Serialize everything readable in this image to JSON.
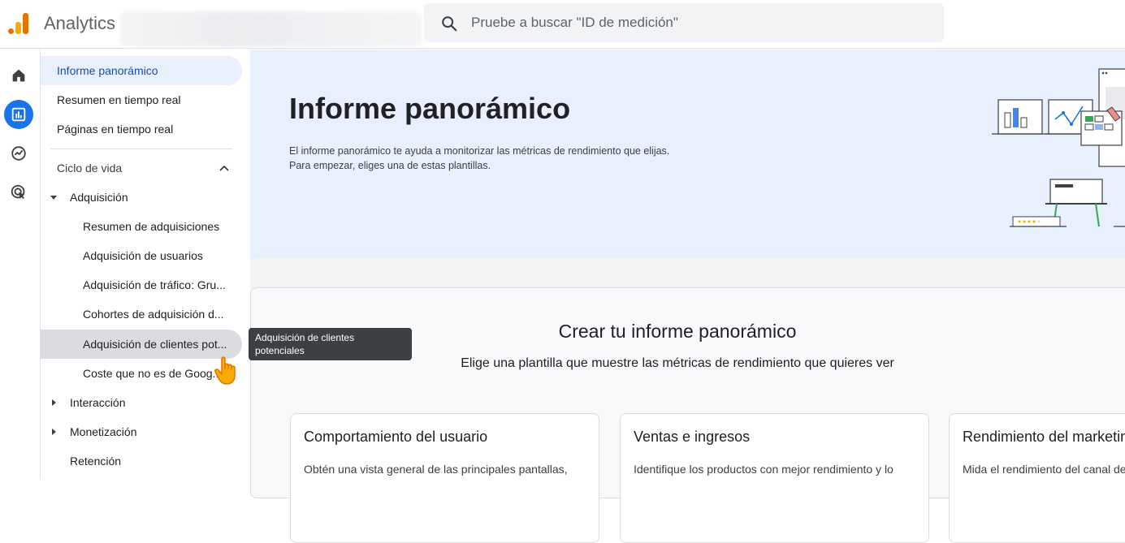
{
  "header": {
    "app_title": "Analytics",
    "search_placeholder": "Pruebe a buscar \"ID de medición\""
  },
  "rail": {
    "items": [
      {
        "icon": "home-icon"
      },
      {
        "icon": "reports-icon",
        "active": true
      },
      {
        "icon": "explore-icon"
      },
      {
        "icon": "advertising-icon"
      }
    ]
  },
  "sidenav": {
    "items": [
      {
        "label": "Informe panorámico"
      },
      {
        "label": "Resumen en tiempo real"
      },
      {
        "label": "Páginas en tiempo real"
      }
    ],
    "section_label": "Ciclo de vida",
    "acquisition": {
      "label": "Adquisición",
      "children": [
        "Resumen de adquisiciones",
        "Adquisición de usuarios",
        "Adquisición de tráfico: Gru...",
        "Cohortes de adquisición d...",
        "Adquisición de clientes pot...",
        "Coste que no es de Goog..."
      ]
    },
    "interaction": "Interacción",
    "monetization": "Monetización",
    "retention": "Retención"
  },
  "tooltip": {
    "text": "Adquisición de clientes potenciales"
  },
  "hero": {
    "title": "Informe panorámico",
    "description": "El informe panorámico te ayuda a monitorizar las métricas de rendimiento que elijas. Para empezar, eliges una de estas plantillas."
  },
  "create": {
    "title": "Crear tu informe panorámico",
    "subtitle": "Elige una plantilla que muestre las métricas de rendimiento que quieres ver"
  },
  "templates": [
    {
      "title": "Comportamiento del usuario",
      "description": "Obtén una vista general de las principales pantallas,"
    },
    {
      "title": "Ventas e ingresos",
      "description": "Identifique los productos con mejor rendimiento y lo"
    },
    {
      "title": "Rendimiento del marketing",
      "description": "Mida el rendimiento del canal de"
    }
  ],
  "colors": {
    "accent": "#1a73e8",
    "hero_bg": "#e8f0fe",
    "logo_orange": "#f9ab00",
    "logo_dark_orange": "#e37400"
  }
}
